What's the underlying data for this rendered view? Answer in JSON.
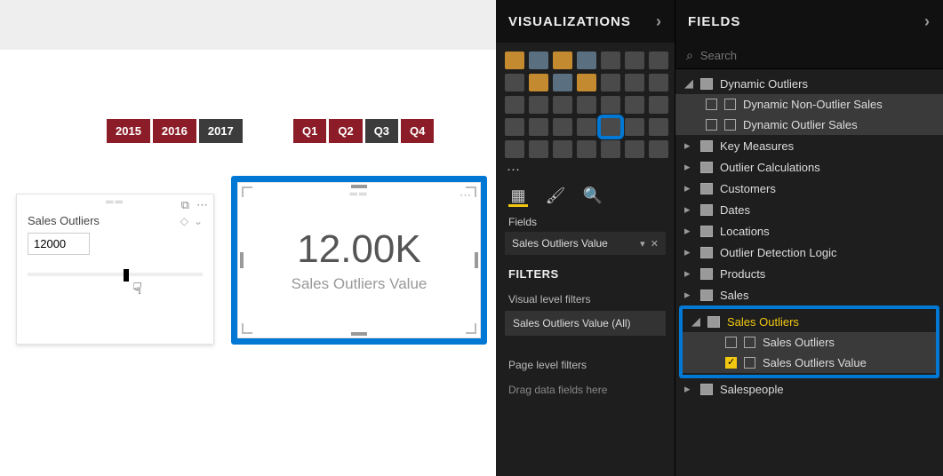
{
  "canvas": {
    "yearPills": [
      {
        "label": "2015",
        "variant": "red"
      },
      {
        "label": "2016",
        "variant": "red"
      },
      {
        "label": "2017",
        "variant": "dark"
      }
    ],
    "quarterPills": [
      {
        "label": "Q1",
        "variant": "red"
      },
      {
        "label": "Q2",
        "variant": "red"
      },
      {
        "label": "Q3",
        "variant": "dark"
      },
      {
        "label": "Q4",
        "variant": "red"
      }
    ],
    "slicer": {
      "title": "Sales Outliers",
      "inputValue": "12000"
    },
    "card": {
      "value": "12.00K",
      "label": "Sales Outliers Value"
    }
  },
  "vizPane": {
    "title": "VISUALIZATIONS",
    "more": "···",
    "sectionFields": "Fields",
    "fieldWell": {
      "label": "Sales Outliers Value"
    },
    "filters": {
      "header": "FILTERS",
      "visualLevel": "Visual level filters",
      "chip": {
        "label": "Sales Outliers Value",
        "suffix": "(All)"
      },
      "pageLevel": "Page level filters",
      "dragHint": "Drag data fields here"
    }
  },
  "fieldsPane": {
    "title": "FIELDS",
    "searchPlaceholder": "Search",
    "tables": [
      {
        "name": "Dynamic Outliers",
        "expanded": true,
        "children": [
          {
            "name": "Dynamic Non-Outlier Sales",
            "kind": "measure"
          },
          {
            "name": "Dynamic Outlier Sales",
            "kind": "measure"
          }
        ]
      },
      {
        "name": "Key Measures"
      },
      {
        "name": "Outlier Calculations"
      },
      {
        "name": "Customers"
      },
      {
        "name": "Dates"
      },
      {
        "name": "Locations"
      },
      {
        "name": "Outlier Detection Logic"
      },
      {
        "name": "Products"
      },
      {
        "name": "Sales"
      },
      {
        "name": "Sales Outliers",
        "highlighted": true,
        "expanded": true,
        "children": [
          {
            "name": "Sales Outliers",
            "kind": "hierarchy",
            "checked": false
          },
          {
            "name": "Sales Outliers Value",
            "kind": "measure",
            "checked": true
          }
        ]
      },
      {
        "name": "Salespeople"
      }
    ]
  },
  "chart_data": {
    "type": "table",
    "title": "Sales Outliers Value",
    "values": [
      12000
    ],
    "display": "12.00K"
  }
}
